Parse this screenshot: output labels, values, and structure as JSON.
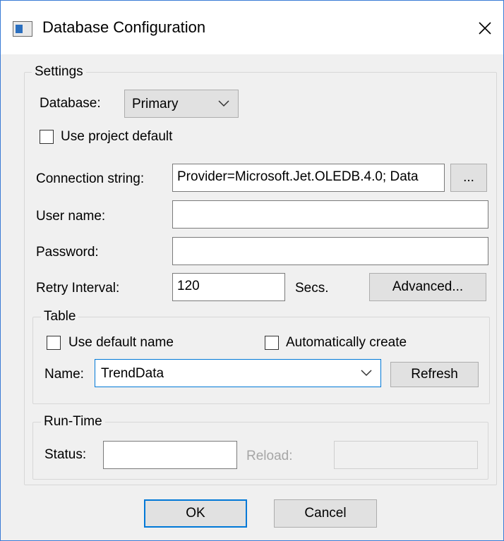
{
  "window": {
    "title": "Database Configuration"
  },
  "settings": {
    "legend": "Settings",
    "database_label": "Database:",
    "database_value": "Primary",
    "use_project_default_label": "Use project default",
    "use_project_default_checked": false,
    "connection_string_label": "Connection string:",
    "connection_string_value": "Provider=Microsoft.Jet.OLEDB.4.0; Data",
    "browse_button_label": "...",
    "user_name_label": "User name:",
    "user_name_value": "",
    "password_label": "Password:",
    "password_value": "",
    "retry_interval_label": "Retry Interval:",
    "retry_interval_value": "120",
    "retry_unit_label": "Secs.",
    "advanced_button_label": "Advanced..."
  },
  "table": {
    "legend": "Table",
    "use_default_name_label": "Use default name",
    "use_default_name_checked": false,
    "auto_create_label": "Automatically create",
    "auto_create_checked": false,
    "name_label": "Name:",
    "name_value": "TrendData",
    "refresh_button_label": "Refresh"
  },
  "runtime": {
    "legend": "Run-Time",
    "status_label": "Status:",
    "status_value": "",
    "reload_label": "Reload:",
    "reload_value": ""
  },
  "footer": {
    "ok_label": "OK",
    "cancel_label": "Cancel"
  },
  "icons": {
    "app": "window-icon",
    "close": "close-icon",
    "dropdown": "chevron-down-icon"
  },
  "colors": {
    "accent": "#0078d7",
    "dialog_background": "#f0f0f0",
    "disabled_text": "#a6a6a6"
  }
}
